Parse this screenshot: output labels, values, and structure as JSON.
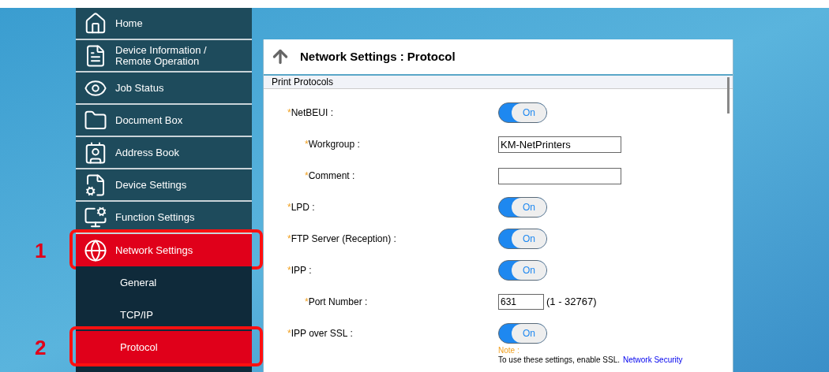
{
  "sidebar": {
    "items": [
      {
        "label": "Home",
        "kind": "main",
        "selected": false
      },
      {
        "label": "Device Information /\nRemote Operation",
        "kind": "main",
        "selected": false
      },
      {
        "label": "Job Status",
        "kind": "main",
        "selected": false
      },
      {
        "label": "Document Box",
        "kind": "main",
        "selected": false
      },
      {
        "label": "Address Book",
        "kind": "main",
        "selected": false
      },
      {
        "label": "Device Settings",
        "kind": "main",
        "selected": false
      },
      {
        "label": "Function Settings",
        "kind": "main",
        "selected": false
      },
      {
        "label": "Network Settings",
        "kind": "main",
        "selected": true,
        "callout": "1"
      },
      {
        "label": "General",
        "kind": "sub",
        "selected": false
      },
      {
        "label": "TCP/IP",
        "kind": "sub",
        "selected": false
      },
      {
        "label": "Protocol",
        "kind": "sub",
        "selected": true,
        "callout": "2"
      }
    ]
  },
  "panel": {
    "title": "Network Settings : Protocol",
    "section": "Print Protocols",
    "rows": [
      {
        "marker": "*",
        "label": "NetBEUI :",
        "kind": "toggle",
        "on": true,
        "state_label": "On",
        "children": [
          {
            "marker": "*",
            "label": "Workgroup :",
            "kind": "text",
            "value": "KM-NetPrinters"
          },
          {
            "marker": "*",
            "label": "Comment :",
            "kind": "text"
          }
        ]
      },
      {
        "marker": "*",
        "label": "LPD :",
        "kind": "toggle",
        "on": true,
        "state_label": "On"
      },
      {
        "marker": "*",
        "label": "FTP Server (Reception) :",
        "kind": "toggle",
        "on": true,
        "state_label": "On"
      },
      {
        "marker": "*",
        "label": "IPP :",
        "kind": "toggle",
        "on": true,
        "state_label": "On",
        "children": [
          {
            "marker": "*",
            "label": "Port Number :",
            "kind": "port",
            "value": "631",
            "range": "(1 - 32767)"
          }
        ]
      },
      {
        "marker": "*",
        "label": "IPP over SSL :",
        "kind": "toggle",
        "on": true,
        "state_label": "On"
      }
    ],
    "note": {
      "heading": "Note :",
      "text": "To use these settings, enable SSL.",
      "link": "Network Security"
    }
  }
}
